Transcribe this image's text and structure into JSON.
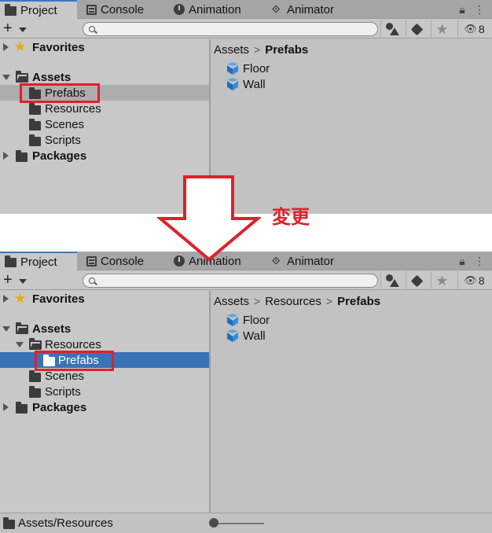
{
  "tabs": {
    "project": "Project",
    "console": "Console",
    "animation": "Animation",
    "animator": "Animator"
  },
  "toolbar": {
    "plus": "+",
    "hidden_count": "8"
  },
  "tree": {
    "favorites": "Favorites",
    "assets": "Assets",
    "resources": "Resources",
    "prefabs": "Prefabs",
    "scenes": "Scenes",
    "scripts": "Scripts",
    "packages": "Packages"
  },
  "top_panel": {
    "breadcrumb": [
      "Assets",
      "Prefabs"
    ],
    "assets": [
      "Floor",
      "Wall"
    ]
  },
  "bottom_panel": {
    "breadcrumb": [
      "Assets",
      "Resources",
      "Prefabs"
    ],
    "assets": [
      "Floor",
      "Wall"
    ],
    "status_path": "Assets/Resources"
  },
  "annotation": {
    "label": "変更",
    "color": "#e0202a"
  },
  "colors": {
    "selection_blue": "#3a72b5",
    "highlight_red": "#e0202a",
    "tab_accent": "#3a78c3"
  }
}
